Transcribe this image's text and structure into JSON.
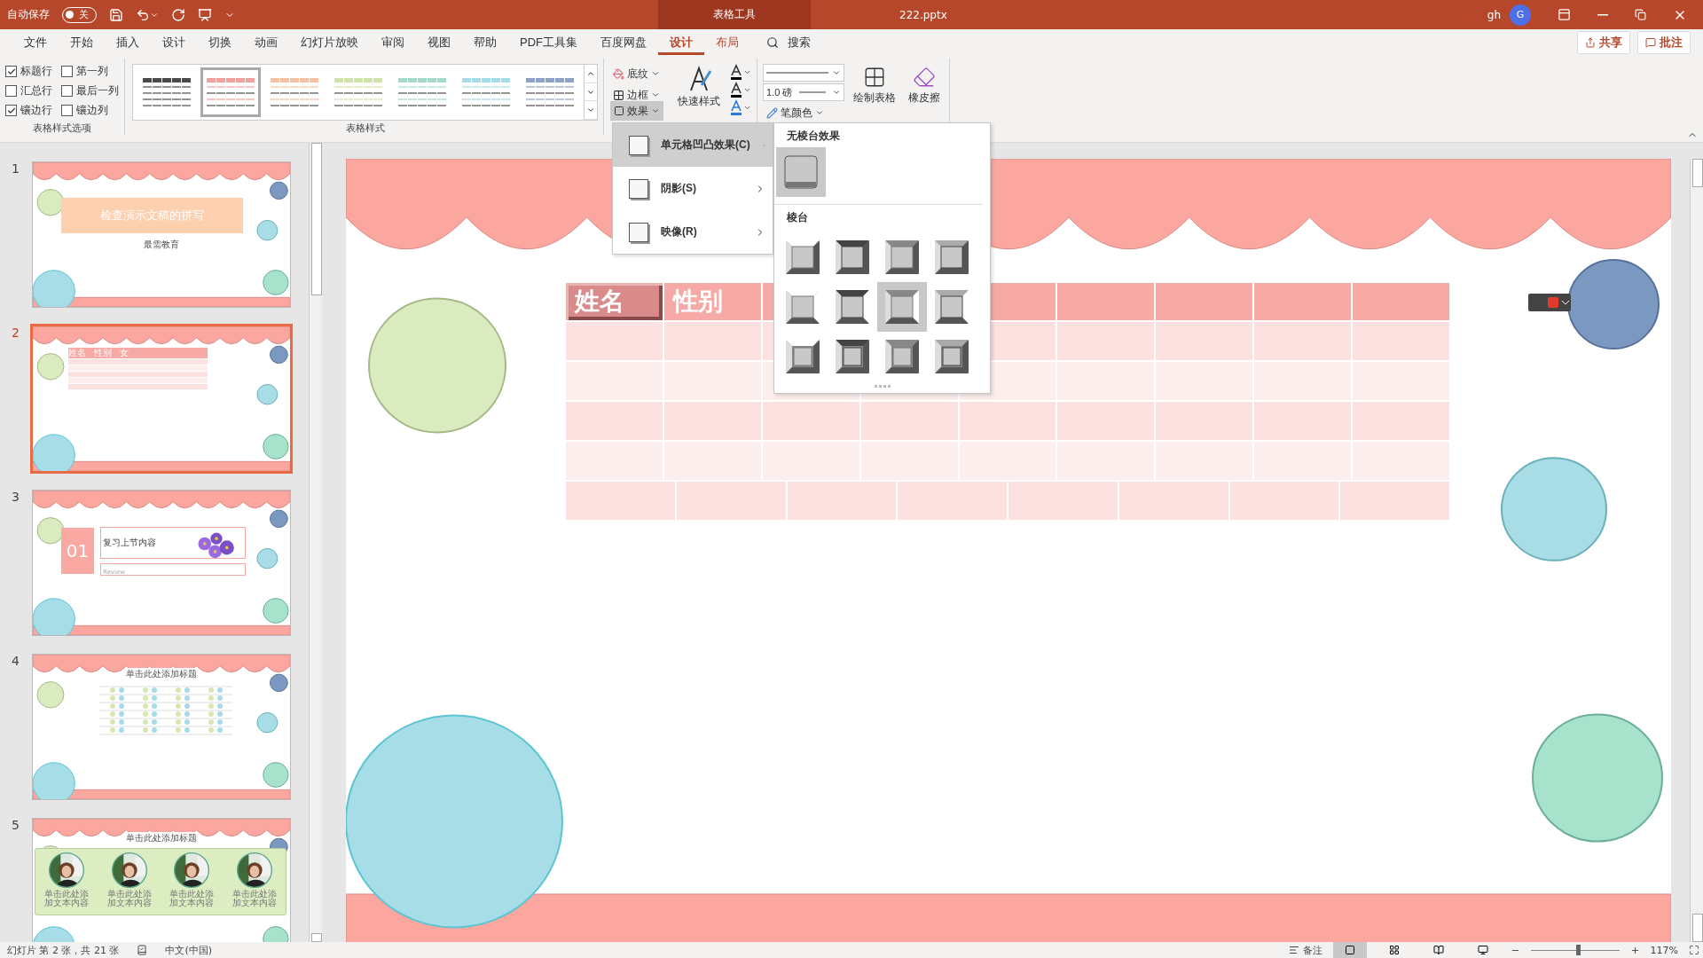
{
  "title_bar": {
    "autosave_label": "自动保存",
    "autosave_toggle": {
      "on": false,
      "label": "关"
    },
    "context_tab": "表格工具",
    "file_name": "222.pptx",
    "user": "gh",
    "avatar": "G"
  },
  "menu_tabs": [
    {
      "label": "文件",
      "kind": "normal",
      "selected": false
    },
    {
      "label": "开始",
      "kind": "normal",
      "selected": false
    },
    {
      "label": "插入",
      "kind": "normal",
      "selected": false
    },
    {
      "label": "设计",
      "kind": "normal",
      "selected": false
    },
    {
      "label": "切换",
      "kind": "normal",
      "selected": false
    },
    {
      "label": "动画",
      "kind": "normal",
      "selected": false
    },
    {
      "label": "幻灯片放映",
      "kind": "normal",
      "selected": false
    },
    {
      "label": "审阅",
      "kind": "normal",
      "selected": false
    },
    {
      "label": "视图",
      "kind": "normal",
      "selected": false
    },
    {
      "label": "帮助",
      "kind": "normal",
      "selected": false
    },
    {
      "label": "PDF工具集",
      "kind": "normal",
      "selected": false
    },
    {
      "label": "百度网盘",
      "kind": "normal",
      "selected": false
    },
    {
      "label": "设计",
      "kind": "contextual",
      "selected": true
    },
    {
      "label": "布局",
      "kind": "contextual",
      "selected": false
    }
  ],
  "search": "搜索",
  "share": "共享",
  "comments": "批注",
  "ribbon": {
    "style_options": {
      "items": [
        {
          "label": "标题行",
          "checked": true
        },
        {
          "label": "第一列",
          "checked": false
        },
        {
          "label": "汇总行",
          "checked": false
        },
        {
          "label": "最后一列",
          "checked": false
        },
        {
          "label": "镶边行",
          "checked": true
        },
        {
          "label": "镶边列",
          "checked": false
        }
      ],
      "group_label": "表格样式选项"
    },
    "table_styles": {
      "styles": [
        {
          "color": "#4a4a4a",
          "selected": false
        },
        {
          "color": "#f2a09b",
          "selected": true
        },
        {
          "color": "#f7c2a0",
          "selected": false
        },
        {
          "color": "#cfe3a8",
          "selected": false
        },
        {
          "color": "#a3dcc6",
          "selected": false
        },
        {
          "color": "#a6dbe8",
          "selected": false
        },
        {
          "color": "#8ea2c8",
          "selected": false
        }
      ],
      "group_label": "表格样式"
    },
    "shading": "底纹",
    "borders": "边框",
    "effects": "效果",
    "quick_styles": "快速样式",
    "pen_weight": "1.0 磅",
    "pen_color": "笔颜色",
    "draw_table": "绘制表格",
    "eraser": "橡皮擦"
  },
  "effects_menu": {
    "items": [
      {
        "label": "单元格凹凸效果(C)",
        "selected": true
      },
      {
        "label": "阴影(S)",
        "selected": false
      },
      {
        "label": "映像(R)",
        "selected": false
      }
    ],
    "submenu": {
      "none_heading": "无棱台效果",
      "none_option": {
        "selected": true
      },
      "bevel_heading": "棱台",
      "bevel_options": [
        {
          "selected": false
        },
        {
          "selected": false
        },
        {
          "selected": false
        },
        {
          "selected": false
        },
        {
          "selected": false
        },
        {
          "selected": false
        },
        {
          "selected": true
        },
        {
          "selected": false
        },
        {
          "selected": false
        },
        {
          "selected": false
        },
        {
          "selected": false
        },
        {
          "selected": false
        }
      ]
    }
  },
  "slides": [
    {
      "number": "1",
      "selected": false,
      "kind": "title",
      "title": "检查演示文稿的拼写",
      "subtitle": "最需教育"
    },
    {
      "number": "2",
      "selected": true,
      "kind": "table",
      "headers": [
        "姓名",
        "性别",
        "女"
      ]
    },
    {
      "number": "3",
      "selected": false,
      "kind": "section",
      "index": "01",
      "title": "复习上节内容",
      "subtitle": "Review"
    },
    {
      "number": "4",
      "selected": false,
      "kind": "chart",
      "title": "单击此处添加标题"
    },
    {
      "number": "5",
      "selected": false,
      "kind": "photos",
      "title": "单击此处添加标题",
      "captions": [
        "单击此处添加文本内容",
        "单击此处添加文本内容",
        "单击此处添加文本内容",
        "单击此处添加文本内容"
      ]
    }
  ],
  "slide": {
    "table": {
      "headers": [
        {
          "text": "姓名",
          "bevel": true
        },
        {
          "text": "性别",
          "bevel": false
        }
      ]
    }
  },
  "status_bar": {
    "slide_info": "幻灯片 第 2 张，共 21 张",
    "language": "中文(中国)",
    "notes": "备注",
    "views": [
      {
        "selected": true
      },
      {
        "selected": false
      },
      {
        "selected": false
      },
      {
        "selected": false
      }
    ],
    "zoom": {
      "level": 0.53,
      "reading": "117%"
    }
  }
}
